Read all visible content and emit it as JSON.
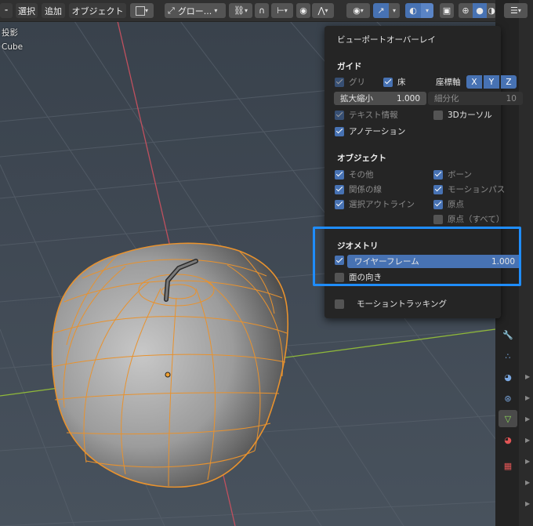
{
  "header": {
    "menu_select": "選択",
    "menu_add": "追加",
    "menu_object": "オブジェクト",
    "transform_orientation": "グロー..."
  },
  "viewport": {
    "projection_label": "投影",
    "object_label": "Cube"
  },
  "overlay": {
    "title": "ビューポートオーバーレイ",
    "guides": {
      "section": "ガイド",
      "grid": "グリ",
      "floor": "床",
      "axes_label": "座標軸",
      "axes": [
        "X",
        "Y",
        "Z"
      ],
      "scale_label": "拡大縮小",
      "scale_value": "1.000",
      "subdivisions_label": "細分化",
      "subdivisions_value": "10",
      "text_info": "テキスト情報",
      "cursor_3d": "3Dカーソル",
      "annotations": "アノテーション"
    },
    "objects": {
      "section": "オブジェクト",
      "extras": "その他",
      "relationship_lines": "関係の線",
      "outline_selected": "選択アウトライン",
      "bones": "ボーン",
      "motion_paths": "モーションパス",
      "origins": "原点",
      "origins_all": "原点（すべて）"
    },
    "geometry": {
      "section": "ジオメトリ",
      "wireframe_label": "ワイヤーフレーム",
      "wireframe_value": "1.000",
      "wireframe_fill": 1.0,
      "face_orientation": "面の向き"
    },
    "motion_tracking": "モーショントラッキング"
  },
  "colors": {
    "accent": "#4772b3",
    "highlight_frame": "#1f8dff",
    "wire": "#e8922e",
    "x_axis": "#c0505e",
    "y_axis": "#8fb83a"
  }
}
